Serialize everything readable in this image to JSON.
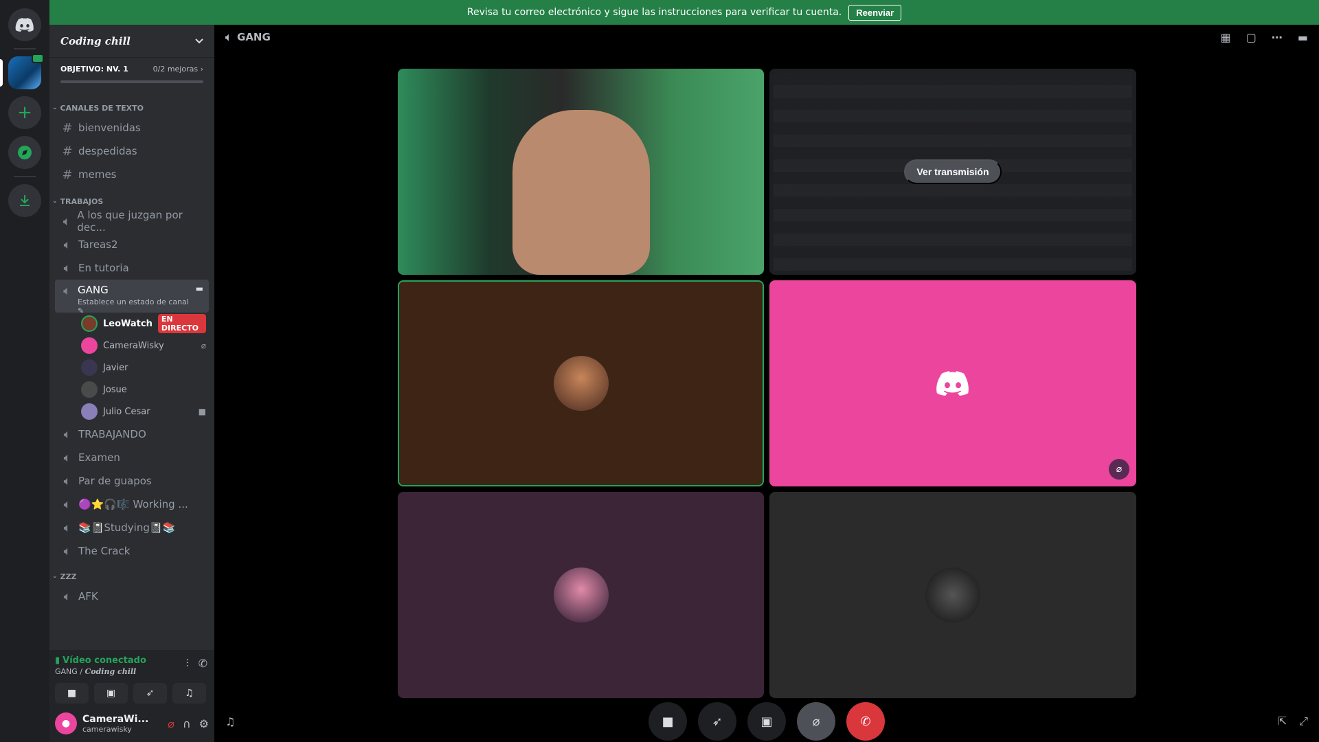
{
  "banner": {
    "message": "Revisa tu correo electrónico y sigue las instrucciones para verificar tu cuenta.",
    "button": "Reenviar"
  },
  "guild": {
    "name": "Coding chill",
    "boost_goal": "OBJETIVO: NV. 1",
    "boost_progress": "0/2 mejoras"
  },
  "categories": {
    "text": "CANALES DE TEXTO",
    "work": "TRABAJOS",
    "zzz": "ZZZ"
  },
  "text_channels": [
    "bienvenidas",
    "despedidas",
    "memes"
  ],
  "voice_channels_top": [
    "A los que juzgan por dec...",
    "Tareas2",
    "En tutoria"
  ],
  "active_channel": {
    "name": "GANG",
    "status_hint": "Establece un estado de canal"
  },
  "voice_users": [
    {
      "name": "LeoWatch",
      "badge": "EN DIRECTO"
    },
    {
      "name": "CameraWisky"
    },
    {
      "name": "Javier"
    },
    {
      "name": "Josue"
    },
    {
      "name": "Julio Cesar"
    }
  ],
  "voice_channels_bottom": [
    "TRABAJANDO",
    "Examen",
    "Par de guapos",
    "🟣⭐🎧🎼 Working ...",
    "📚📓Studying📓📚",
    "The Crack"
  ],
  "afk_channel": "AFK",
  "voice_panel": {
    "status": "Vídeo conectado",
    "channel": "GANG / ",
    "guild": "Coding chill"
  },
  "user": {
    "display": "CameraWi...",
    "handle": "camerawisky"
  },
  "stage": {
    "title": "GANG",
    "stream_button": "Ver transmisión"
  },
  "colors": {
    "banner": "#248046",
    "live": "#da373c",
    "discord_pink": "#eb459e",
    "speaking_green": "#23a55a"
  }
}
